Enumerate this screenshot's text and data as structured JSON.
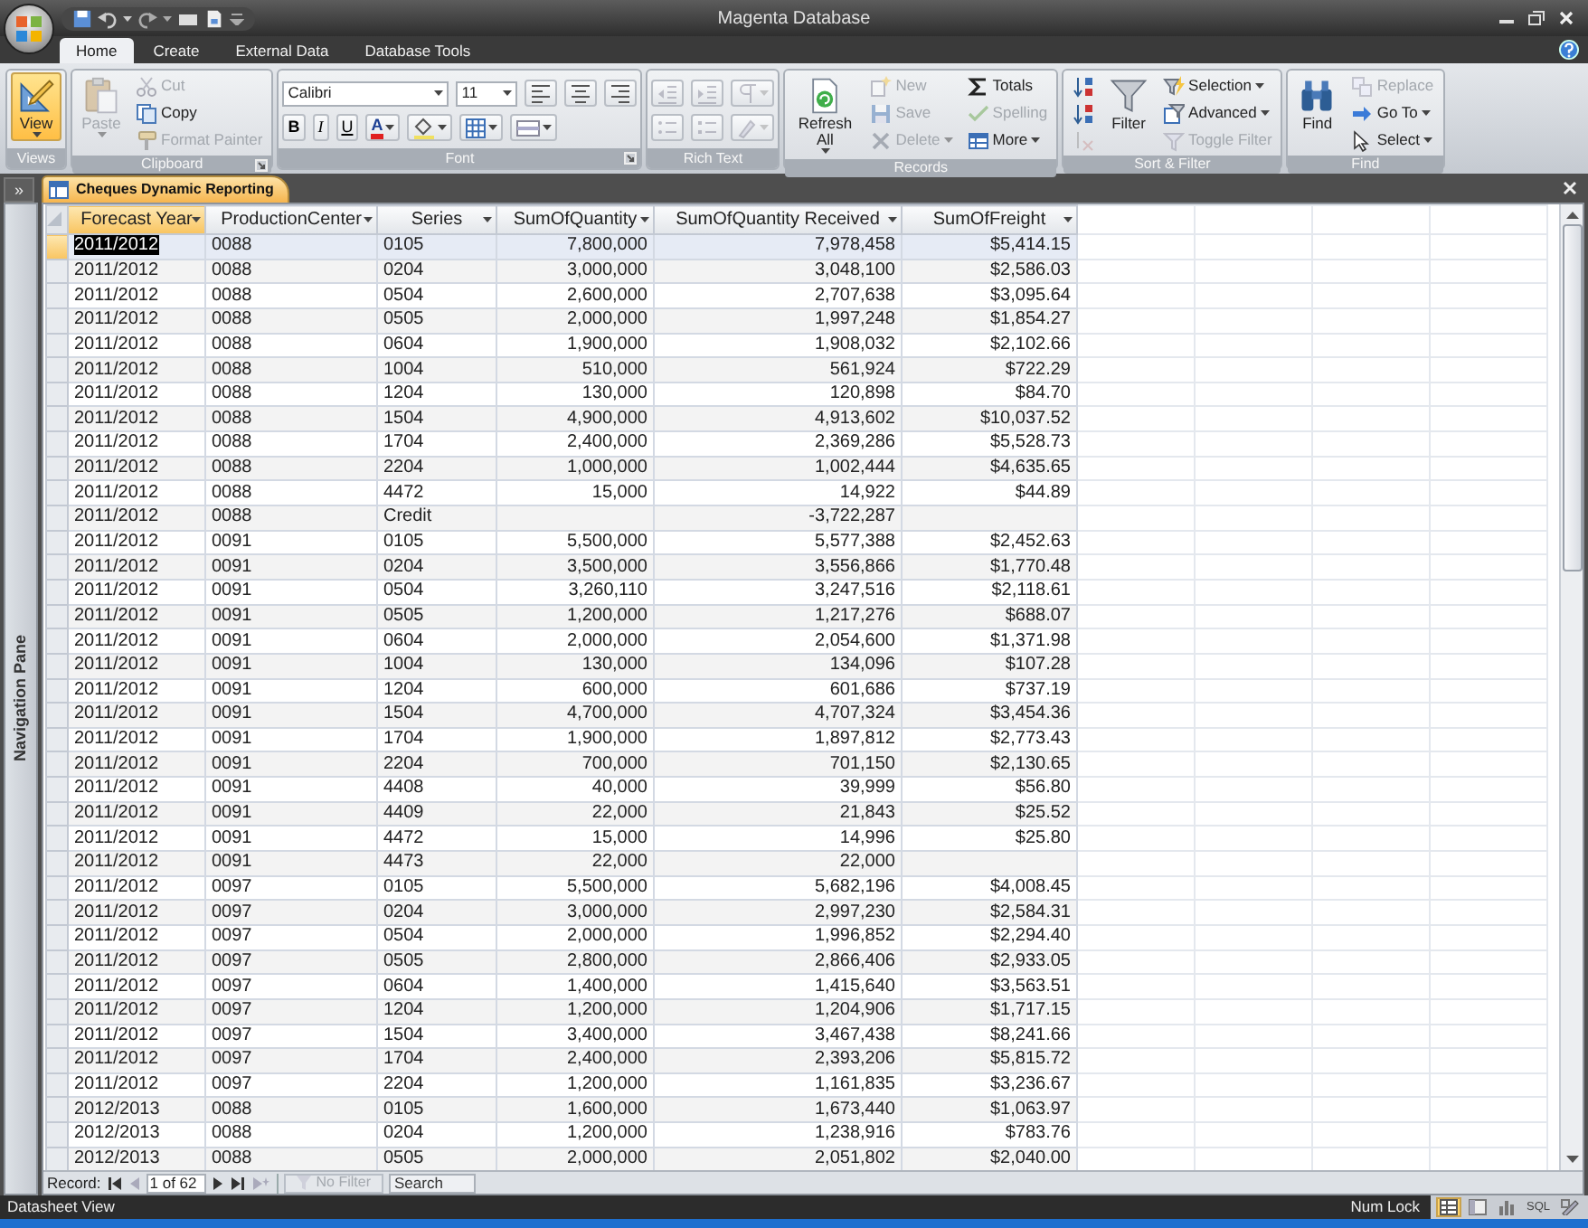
{
  "window": {
    "title": "Magenta Database"
  },
  "tabs": [
    {
      "label": "Home",
      "selected": true
    },
    {
      "label": "Create",
      "selected": false
    },
    {
      "label": "External Data",
      "selected": false
    },
    {
      "label": "Database Tools",
      "selected": false
    }
  ],
  "ribbon": {
    "groups": [
      {
        "label": "Views",
        "kind": "buttons",
        "launcher": false,
        "items": [
          {
            "kind": "large",
            "label": "View",
            "dropdown": true,
            "disabled": false,
            "highlighted": true
          }
        ]
      },
      {
        "label": "Clipboard",
        "kind": "buttons",
        "launcher": true,
        "items": [
          {
            "kind": "large",
            "label": "Paste",
            "dropdown": true,
            "disabled": true,
            "highlighted": false
          },
          {
            "kind": "small",
            "label": "Cut",
            "dropdown": false,
            "disabled": true,
            "highlighted": false
          },
          {
            "kind": "small",
            "label": "Copy",
            "dropdown": false,
            "disabled": false,
            "highlighted": false
          },
          {
            "kind": "small",
            "label": "Format Painter",
            "dropdown": false,
            "disabled": true,
            "highlighted": false
          }
        ]
      },
      {
        "label": "Font",
        "kind": "font",
        "launcher": true,
        "font_name": "Calibri",
        "font_size": "11",
        "style_buttons": [
          {
            "label": "B",
            "kind": "bold"
          },
          {
            "label": "I",
            "kind": "italic"
          },
          {
            "label": "U",
            "kind": "underline"
          }
        ],
        "color_button": "A"
      },
      {
        "label": "Rich Text",
        "kind": "richtext",
        "launcher": false
      },
      {
        "label": "Records",
        "kind": "buttons",
        "launcher": false,
        "items": [
          {
            "kind": "large",
            "label": "Refresh All",
            "dropdown": true,
            "disabled": false,
            "highlighted": false
          },
          {
            "kind": "small",
            "label": "New",
            "dropdown": false,
            "disabled": true,
            "highlighted": false
          },
          {
            "kind": "small",
            "label": "Save",
            "dropdown": false,
            "disabled": true,
            "highlighted": false
          },
          {
            "kind": "small",
            "label": "Delete",
            "dropdown": true,
            "disabled": true,
            "highlighted": false
          },
          {
            "kind": "small",
            "label": "Totals",
            "dropdown": false,
            "disabled": false,
            "highlighted": false
          },
          {
            "kind": "small",
            "label": "Spelling",
            "dropdown": false,
            "disabled": true,
            "highlighted": false
          },
          {
            "kind": "small",
            "label": "More",
            "dropdown": true,
            "disabled": false,
            "highlighted": false
          }
        ]
      },
      {
        "label": "Sort & Filter",
        "kind": "buttons",
        "launcher": false,
        "items": [
          {
            "kind": "icon",
            "dropdown": false,
            "disabled": false,
            "highlighted": false
          },
          {
            "kind": "icon",
            "dropdown": false,
            "disabled": false,
            "highlighted": false
          },
          {
            "kind": "icon",
            "dropdown": false,
            "disabled": true,
            "highlighted": false
          },
          {
            "kind": "large",
            "label": "Filter",
            "dropdown": false,
            "disabled": false,
            "highlighted": false
          },
          {
            "kind": "small",
            "label": "Selection",
            "dropdown": true,
            "disabled": false,
            "highlighted": false
          },
          {
            "kind": "small",
            "label": "Advanced",
            "dropdown": true,
            "disabled": false,
            "highlighted": false
          },
          {
            "kind": "small",
            "label": "Toggle Filter",
            "dropdown": false,
            "disabled": true,
            "highlighted": false
          }
        ]
      },
      {
        "label": "Find",
        "kind": "buttons",
        "launcher": false,
        "items": [
          {
            "kind": "large",
            "label": "Find",
            "dropdown": false,
            "disabled": false,
            "highlighted": false
          },
          {
            "kind": "small",
            "label": "Replace",
            "dropdown": false,
            "disabled": true,
            "highlighted": false
          },
          {
            "kind": "small",
            "label": "Go To",
            "dropdown": true,
            "disabled": false,
            "highlighted": false
          },
          {
            "kind": "small",
            "label": "Select",
            "dropdown": true,
            "disabled": false,
            "highlighted": false
          }
        ]
      }
    ]
  },
  "navigation_pane": {
    "toggle": "»",
    "label": "Navigation Pane"
  },
  "document_tabs": [
    {
      "label": "Cheques Dynamic Reporting",
      "selected": true
    }
  ],
  "table": {
    "columns": [
      {
        "label": "Forecast Year",
        "kind": "text",
        "selected": true
      },
      {
        "label": "ProductionCenter",
        "kind": "text",
        "selected": false
      },
      {
        "label": "Series",
        "kind": "text",
        "selected": false
      },
      {
        "label": "SumOfQuantity",
        "kind": "number",
        "selected": false
      },
      {
        "label": "SumOfQuantity Received",
        "kind": "number",
        "selected": false
      },
      {
        "label": "SumOfFreight",
        "kind": "number",
        "selected": false
      }
    ],
    "rows": [
      {
        "selected": true,
        "cells": [
          "2011/2012",
          "0088",
          "0105",
          "7,800,000",
          "7,978,458",
          "$5,414.15"
        ]
      },
      {
        "selected": false,
        "cells": [
          "2011/2012",
          "0088",
          "0204",
          "3,000,000",
          "3,048,100",
          "$2,586.03"
        ]
      },
      {
        "selected": false,
        "cells": [
          "2011/2012",
          "0088",
          "0504",
          "2,600,000",
          "2,707,638",
          "$3,095.64"
        ]
      },
      {
        "selected": false,
        "cells": [
          "2011/2012",
          "0088",
          "0505",
          "2,000,000",
          "1,997,248",
          "$1,854.27"
        ]
      },
      {
        "selected": false,
        "cells": [
          "2011/2012",
          "0088",
          "0604",
          "1,900,000",
          "1,908,032",
          "$2,102.66"
        ]
      },
      {
        "selected": false,
        "cells": [
          "2011/2012",
          "0088",
          "1004",
          "510,000",
          "561,924",
          "$722.29"
        ]
      },
      {
        "selected": false,
        "cells": [
          "2011/2012",
          "0088",
          "1204",
          "130,000",
          "120,898",
          "$84.70"
        ]
      },
      {
        "selected": false,
        "cells": [
          "2011/2012",
          "0088",
          "1504",
          "4,900,000",
          "4,913,602",
          "$10,037.52"
        ]
      },
      {
        "selected": false,
        "cells": [
          "2011/2012",
          "0088",
          "1704",
          "2,400,000",
          "2,369,286",
          "$5,528.73"
        ]
      },
      {
        "selected": false,
        "cells": [
          "2011/2012",
          "0088",
          "2204",
          "1,000,000",
          "1,002,444",
          "$4,635.65"
        ]
      },
      {
        "selected": false,
        "cells": [
          "2011/2012",
          "0088",
          "4472",
          "15,000",
          "14,922",
          "$44.89"
        ]
      },
      {
        "selected": false,
        "cells": [
          "2011/2012",
          "0088",
          "Credit",
          null,
          "-3,722,287",
          null
        ]
      },
      {
        "selected": false,
        "cells": [
          "2011/2012",
          "0091",
          "0105",
          "5,500,000",
          "5,577,388",
          "$2,452.63"
        ]
      },
      {
        "selected": false,
        "cells": [
          "2011/2012",
          "0091",
          "0204",
          "3,500,000",
          "3,556,866",
          "$1,770.48"
        ]
      },
      {
        "selected": false,
        "cells": [
          "2011/2012",
          "0091",
          "0504",
          "3,260,110",
          "3,247,516",
          "$2,118.61"
        ]
      },
      {
        "selected": false,
        "cells": [
          "2011/2012",
          "0091",
          "0505",
          "1,200,000",
          "1,217,276",
          "$688.07"
        ]
      },
      {
        "selected": false,
        "cells": [
          "2011/2012",
          "0091",
          "0604",
          "2,000,000",
          "2,054,600",
          "$1,371.98"
        ]
      },
      {
        "selected": false,
        "cells": [
          "2011/2012",
          "0091",
          "1004",
          "130,000",
          "134,096",
          "$107.28"
        ]
      },
      {
        "selected": false,
        "cells": [
          "2011/2012",
          "0091",
          "1204",
          "600,000",
          "601,686",
          "$737.19"
        ]
      },
      {
        "selected": false,
        "cells": [
          "2011/2012",
          "0091",
          "1504",
          "4,700,000",
          "4,707,324",
          "$3,454.36"
        ]
      },
      {
        "selected": false,
        "cells": [
          "2011/2012",
          "0091",
          "1704",
          "1,900,000",
          "1,897,812",
          "$2,773.43"
        ]
      },
      {
        "selected": false,
        "cells": [
          "2011/2012",
          "0091",
          "2204",
          "700,000",
          "701,150",
          "$2,130.65"
        ]
      },
      {
        "selected": false,
        "cells": [
          "2011/2012",
          "0091",
          "4408",
          "40,000",
          "39,999",
          "$56.80"
        ]
      },
      {
        "selected": false,
        "cells": [
          "2011/2012",
          "0091",
          "4409",
          "22,000",
          "21,843",
          "$25.52"
        ]
      },
      {
        "selected": false,
        "cells": [
          "2011/2012",
          "0091",
          "4472",
          "15,000",
          "14,996",
          "$25.80"
        ]
      },
      {
        "selected": false,
        "cells": [
          "2011/2012",
          "0091",
          "4473",
          "22,000",
          "22,000",
          null
        ]
      },
      {
        "selected": false,
        "cells": [
          "2011/2012",
          "0097",
          "0105",
          "5,500,000",
          "5,682,196",
          "$4,008.45"
        ]
      },
      {
        "selected": false,
        "cells": [
          "2011/2012",
          "0097",
          "0204",
          "3,000,000",
          "2,997,230",
          "$2,584.31"
        ]
      },
      {
        "selected": false,
        "cells": [
          "2011/2012",
          "0097",
          "0504",
          "2,000,000",
          "1,996,852",
          "$2,294.40"
        ]
      },
      {
        "selected": false,
        "cells": [
          "2011/2012",
          "0097",
          "0505",
          "2,800,000",
          "2,866,406",
          "$2,933.05"
        ]
      },
      {
        "selected": false,
        "cells": [
          "2011/2012",
          "0097",
          "0604",
          "1,400,000",
          "1,415,640",
          "$3,563.51"
        ]
      },
      {
        "selected": false,
        "cells": [
          "2011/2012",
          "0097",
          "1204",
          "1,200,000",
          "1,204,906",
          "$1,717.15"
        ]
      },
      {
        "selected": false,
        "cells": [
          "2011/2012",
          "0097",
          "1504",
          "3,400,000",
          "3,467,438",
          "$8,241.66"
        ]
      },
      {
        "selected": false,
        "cells": [
          "2011/2012",
          "0097",
          "1704",
          "2,400,000",
          "2,393,206",
          "$5,815.72"
        ]
      },
      {
        "selected": false,
        "cells": [
          "2011/2012",
          "0097",
          "2204",
          "1,200,000",
          "1,161,835",
          "$3,236.67"
        ]
      },
      {
        "selected": false,
        "cells": [
          "2012/2013",
          "0088",
          "0105",
          "1,600,000",
          "1,673,440",
          "$1,063.97"
        ]
      },
      {
        "selected": false,
        "cells": [
          "2012/2013",
          "0088",
          "0204",
          "1,200,000",
          "1,238,916",
          "$783.76"
        ]
      },
      {
        "selected": false,
        "cells": [
          "2012/2013",
          "0088",
          "0505",
          "2,000,000",
          "2,051,802",
          "$2,040.00"
        ]
      }
    ]
  },
  "record_bar": {
    "label": "Record:",
    "position": "1 of 62",
    "nav_buttons": [
      {
        "kind": "first",
        "disabled": false
      },
      {
        "kind": "prev",
        "disabled": true
      },
      {
        "kind": "next",
        "disabled": false
      },
      {
        "kind": "last",
        "disabled": false
      },
      {
        "kind": "new",
        "disabled": true
      }
    ],
    "filter": {
      "label": "No Filter",
      "disabled": true
    },
    "search": {
      "placeholder": "Search"
    }
  },
  "status_bar": {
    "text": "Datasheet View",
    "num_lock": "Num Lock",
    "views": [
      {
        "kind": "datasheet",
        "selected": true
      },
      {
        "kind": "pivottable",
        "selected": false
      },
      {
        "kind": "pivotchart",
        "selected": false
      },
      {
        "kind": "sql",
        "label": "SQL",
        "selected": false
      },
      {
        "kind": "design",
        "selected": false
      }
    ]
  }
}
